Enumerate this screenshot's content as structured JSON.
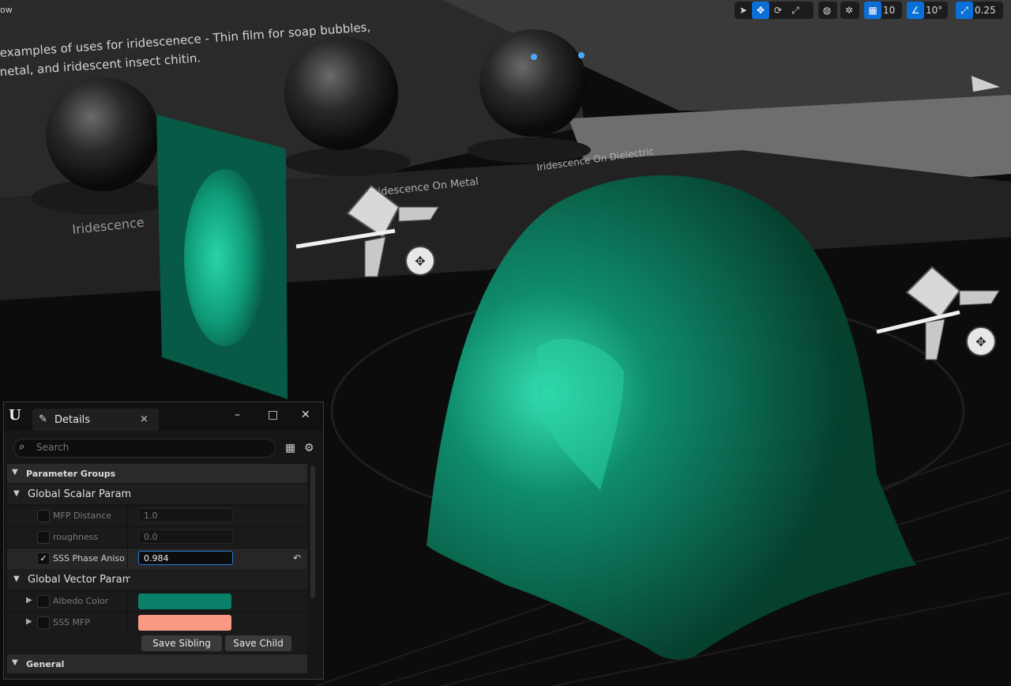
{
  "viewport": {
    "top_left_label": "ow",
    "scene_text": {
      "headline_line1": "examples of uses for iridescenece - Thin film for soap bubbles,",
      "headline_line2": "netal, and iridescent insect chitin.",
      "label_iridescence": "Iridescence",
      "label_on_metal": "Iridescence On Metal",
      "label_on_dielectric": "Iridescence On Dielectric"
    },
    "toolbar": {
      "grid_snap_value": "10",
      "rotation_snap_value": "10°",
      "scale_snap_value": "0.25",
      "icons": [
        "select-icon",
        "translate-icon",
        "rotate-icon",
        "scale-icon",
        "world-icon",
        "surface-snap-icon",
        "grid-snap-icon",
        "rotation-snap-icon",
        "scale-snap-icon"
      ]
    },
    "colors": {
      "cloth": "#0a6b52",
      "cloth_highlight": "#29d6a8",
      "accent": "#0b6fd8"
    }
  },
  "details": {
    "tab_label": "Details",
    "search_placeholder": "Search",
    "sections": {
      "parameter_groups": "Parameter Groups",
      "global_scalar": "Global Scalar Paramete",
      "global_vector": "Global Vector Paramet",
      "general": "General"
    },
    "scalar_params": [
      {
        "name": "MFP Distance",
        "value": "1.0",
        "enabled": false
      },
      {
        "name": "roughness",
        "value": "0.0",
        "enabled": false
      },
      {
        "name": "SSS Phase Aniso",
        "value": "0.984",
        "enabled": true
      }
    ],
    "vector_params": [
      {
        "name": "Albedo Color",
        "color": "#0a8068",
        "enabled": false
      },
      {
        "name": "SSS MFP",
        "color": "#fa9a82",
        "enabled": false
      }
    ],
    "buttons": {
      "save_sibling": "Save Sibling",
      "save_child": "Save Child"
    }
  }
}
